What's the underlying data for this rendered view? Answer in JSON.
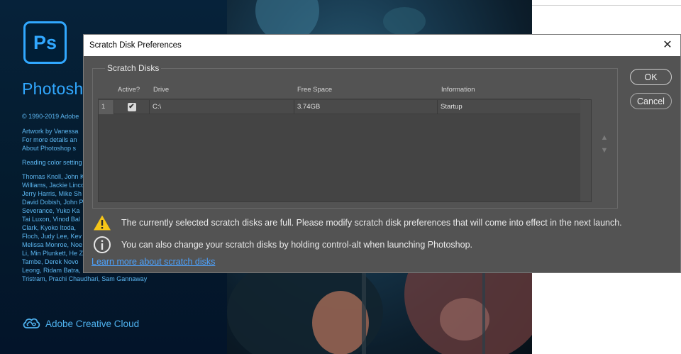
{
  "splash": {
    "logo_text": "Ps",
    "app_name": "Photoshop",
    "copyright": "© 1990-2019 Adobe",
    "artwork_lines": [
      "Artwork by Vanessa",
      "For more details an",
      "About Photoshop s"
    ],
    "reading": "Reading color setting",
    "credits_lines": [
      "Thomas Knoll, John K",
      "Williams, Jackie Linco",
      "Jerry Harris, Mike Sh",
      "David Dobish, John P",
      "Severance, Yuko Ka",
      "Tai Luxon, Vinod Bal",
      "Clark, Kyoko Itoda,",
      "Floch, Judy Lee, Kev",
      "Melissa Monroe, Noe",
      "Li, Min Plunkett, He Z",
      "Tambe, Derek Novo",
      "Leong, Ridam Batra,",
      "Tristram, Prachi Chaudhari, Sam Gannaway"
    ],
    "cc_label": "Adobe Creative Cloud",
    "brand_color": "#31a8ff"
  },
  "dialog": {
    "title": "Scratch Disk Preferences",
    "close_label": "✕",
    "group_label": "Scratch Disks",
    "columns": [
      "Active?",
      "Drive",
      "Free Space",
      "Information"
    ],
    "rows": [
      {
        "index": "1",
        "active": true,
        "drive": "C:\\",
        "free_space": "3.74GB",
        "information": "Startup"
      }
    ],
    "move_up_icon": "arrow-up-icon",
    "move_down_icon": "arrow-down-icon",
    "ok_label": "OK",
    "cancel_label": "Cancel",
    "warning_text": "The currently selected scratch disks are full. Please modify scratch disk preferences that will come into effect in the next launch.",
    "info_text": "You can also change your scratch disks by holding control-alt when launching Photoshop.",
    "link_text": "Learn more about scratch disks",
    "link_color": "#4da3ff",
    "warning_color": "#f5c518"
  }
}
